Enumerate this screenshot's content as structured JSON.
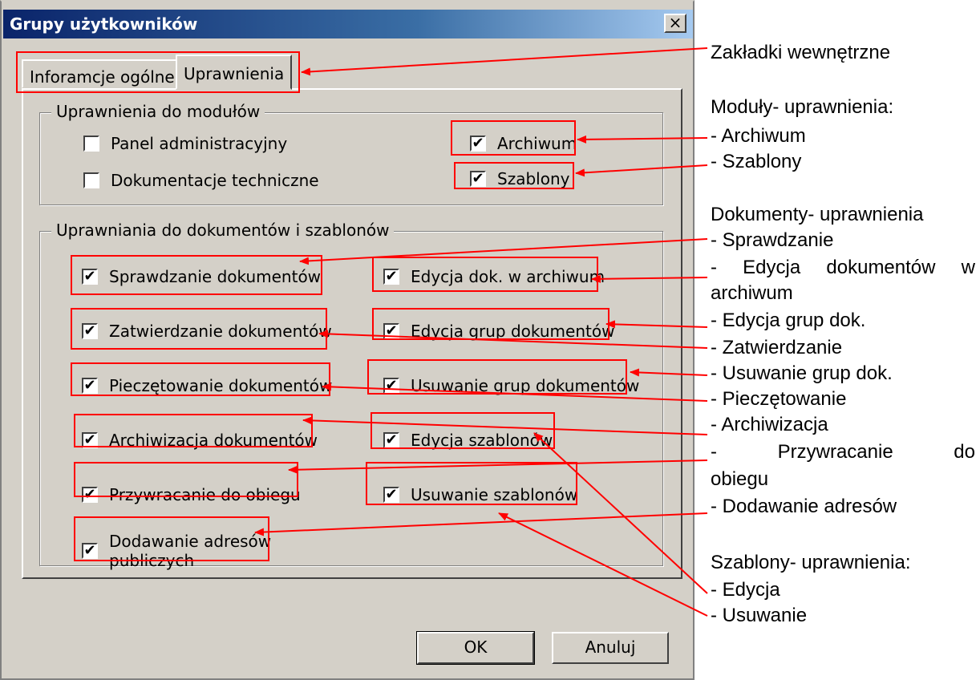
{
  "dialog": {
    "title": "Grupy użytkowników",
    "close_glyph": "×",
    "tabs": [
      {
        "label": "Inforamcje ogólne",
        "active": false
      },
      {
        "label": "Uprawnienia",
        "active": true
      }
    ],
    "modules_group": {
      "legend": "Uprawnienia do modułów",
      "items": [
        {
          "label": "Panel administracyjny",
          "checked": false
        },
        {
          "label": "Dokumentacje techniczne",
          "checked": false
        },
        {
          "label": "Archiwum",
          "checked": true
        },
        {
          "label": "Szablony",
          "checked": true
        }
      ]
    },
    "documents_group": {
      "legend": "Uprawniania do dokumentów i szablonów",
      "left": [
        {
          "label": "Sprawdzanie dokumentów",
          "checked": true
        },
        {
          "label": "Zatwierdzanie dokumentów",
          "checked": true
        },
        {
          "label": "Pieczętowanie dokumentów",
          "checked": true
        },
        {
          "label": "Archiwizacja dokumentów",
          "checked": true
        },
        {
          "label": "Przywracanie do obiegu",
          "checked": true
        },
        {
          "label": "Dodawanie adresów publiczych",
          "line1": "Dodawanie adresów",
          "line2": "publiczych",
          "checked": true
        }
      ],
      "right": [
        {
          "label": "Edycja dok. w archiwum",
          "checked": true
        },
        {
          "label": "Edycja grup dokumentów",
          "checked": true
        },
        {
          "label": "Usuwanie grup dokumentów",
          "checked": true
        },
        {
          "label": "Edycja szablonów",
          "checked": true
        },
        {
          "label": "Usuwanie szablonów",
          "checked": true
        }
      ]
    },
    "buttons": {
      "ok": "OK",
      "cancel": "Anuluj"
    }
  },
  "annotations": {
    "tabs": "Zakładki wewnętrzne",
    "modules_header": "Moduły- uprawnienia:",
    "modules_archiwum": "- Archiwum",
    "modules_szablony": "- Szablony",
    "documents_header": "Dokumenty- uprawnienia",
    "doc_sprawdzanie": "- Sprawdzanie",
    "doc_edycja_line1": "- Edycja dokumentów w",
    "doc_edycja_line2": "archiwum",
    "doc_edycja_grup": "- Edycja grup dok.",
    "doc_zatwierdzanie": "- Zatwierdzanie",
    "doc_usuwanie_grup": "- Usuwanie grup dok.",
    "doc_pieczetowanie": "- Pieczętowanie",
    "doc_archiwizacja": "- Archiwizacja",
    "doc_przywracanie_line1": "- Przywracanie do",
    "doc_przywracanie_line2": "obiegu",
    "doc_dodawanie": "- Dodawanie adresów",
    "templates_header": "Szablony- uprawnienia:",
    "tpl_edycja": "- Edycja",
    "tpl_usuwanie": "- Usuwanie"
  },
  "colors": {
    "highlight": "#ff0000",
    "titlebar": "#0a246a",
    "face": "#d4d0c8"
  }
}
